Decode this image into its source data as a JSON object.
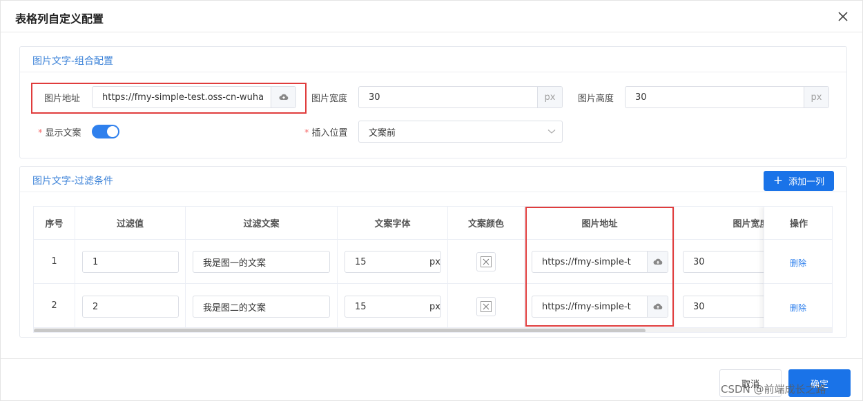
{
  "dialog": {
    "title": "表格列自定义配置"
  },
  "section1": {
    "title": "图片文字-组合配置",
    "image_url_label": "图片地址",
    "image_url_value": "https://fmy-simple-test.oss-cn-wuha",
    "image_width_label": "图片宽度",
    "image_width_value": "30",
    "image_height_label": "图片高度",
    "image_height_value": "30",
    "unit": "px",
    "show_text_label": "显示文案",
    "show_text_on": true,
    "insert_pos_label": "插入位置",
    "insert_pos_value": "文案前",
    "required_mark": "*"
  },
  "section2": {
    "title": "图片文字-过滤条件",
    "add_button": "添加一列",
    "add_button_icon": "+",
    "columns": [
      "序号",
      "过滤值",
      "过滤文案",
      "文案字体",
      "文案颜色",
      "图片地址",
      "图片宽度",
      "操作"
    ],
    "rows": [
      {
        "index": "1",
        "filter_value": "1",
        "filter_text": "我是图一的文案",
        "font_size": "15",
        "unit": "px",
        "image_url": "https://fmy-simple-t",
        "image_width": "30",
        "action": "删除"
      },
      {
        "index": "2",
        "filter_value": "2",
        "filter_text": "我是图二的文案",
        "font_size": "15",
        "unit": "px",
        "image_url": "https://fmy-simple-t",
        "image_width": "30",
        "action": "删除"
      }
    ]
  },
  "footer": {
    "cancel": "取消",
    "ok": "确定"
  },
  "watermark": "CSDN @前端成长之路",
  "colors": {
    "accent": "#1a73e8",
    "title_blue": "#3b82d8",
    "highlight_red": "#e03c3c",
    "required": "#f56c6c"
  },
  "icons": {
    "close": "close-icon",
    "upload": "cloud-upload-icon",
    "arrow": "chevron-down-icon",
    "color": "no-color-icon"
  }
}
